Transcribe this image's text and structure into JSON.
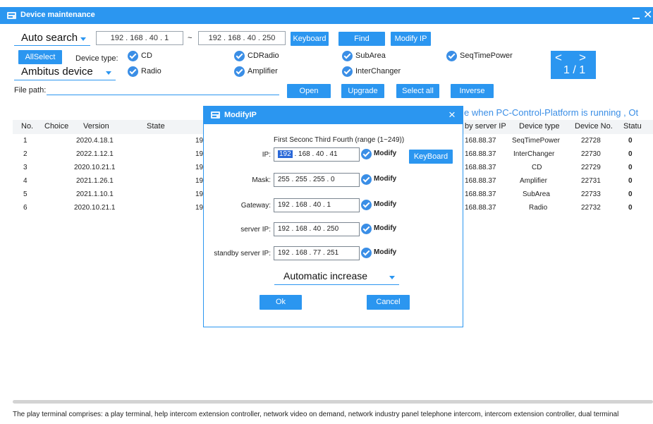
{
  "window": {
    "title": "Device maintenance"
  },
  "search": {
    "mode": "Auto search",
    "ip_start": "192  .  168  .  40  .   1",
    "separator": "~",
    "ip_end": "192  .  168  .  40  .  250",
    "keyboard_label": "Keyboard",
    "find_label": "Find",
    "modify_ip_label": "Modify IP"
  },
  "filter": {
    "allselect_label": "AllSelect",
    "device_type_label": "Device type:",
    "ambitus": "Ambitus device",
    "types": [
      {
        "label": "CD"
      },
      {
        "label": "CDRadio"
      },
      {
        "label": "SubArea"
      },
      {
        "label": "SeqTimePower"
      },
      {
        "label": "Radio"
      },
      {
        "label": "Amplifier"
      },
      {
        "label": "InterChanger"
      }
    ]
  },
  "pager": {
    "prev": "<",
    "next": ">",
    "page": "1 / 1"
  },
  "file": {
    "path_label": "File path:",
    "open_label": "Open",
    "upgrade_label": "Upgrade",
    "select_all_label": "Select all",
    "inverse_label": "Inverse"
  },
  "marquee": "e when PC-Control-Platform is running ,  Ot",
  "table": {
    "headers": {
      "no": "No.",
      "choice": "Choice",
      "version": "Version",
      "state": "State",
      "server_ip": "by server IP",
      "device_type": "Device type",
      "device_no": "Device No.",
      "status": "Statu"
    },
    "rows": [
      {
        "no": "1",
        "version": "2020.4.18.1",
        "ip": "19",
        "server_ip": "168.88.37",
        "device_type": "SeqTimePower",
        "device_no": "22728",
        "status": "0"
      },
      {
        "no": "2",
        "version": "2022.1.12.1",
        "ip": "19",
        "server_ip": "168.88.37",
        "device_type": "InterChanger",
        "device_no": "22730",
        "status": "0"
      },
      {
        "no": "3",
        "version": "2020.10.21.1",
        "ip": "19",
        "server_ip": "168.88.37",
        "device_type": "CD",
        "device_no": "22729",
        "status": "0"
      },
      {
        "no": "4",
        "version": "2021.1.26.1",
        "ip": "19",
        "server_ip": "168.88.37",
        "device_type": "Amplifier",
        "device_no": "22731",
        "status": "0"
      },
      {
        "no": "5",
        "version": "2021.1.10.1",
        "ip": "19",
        "server_ip": "168.88.37",
        "device_type": "SubArea",
        "device_no": "22733",
        "status": "0"
      },
      {
        "no": "6",
        "version": "2020.10.21.1",
        "ip": "19",
        "server_ip": "168.88.37",
        "device_type": "Radio",
        "device_no": "22732",
        "status": "0"
      }
    ]
  },
  "bottom_text": "The play terminal comprises: a play terminal, help intercom extension controller, network video on demand, network industry panel telephone intercom, intercom extension controller, dual terminal",
  "dialog": {
    "title": "ModifyIP",
    "close": "×",
    "header_hint": "First   Seconc  Third   Fourth (range (1~249))",
    "keyboard_label": "KeyBoard",
    "modify_label": "Modify",
    "ip_label": "IP:",
    "ip_first": "192",
    "ip_rest": " .  168  .  40  .  41",
    "mask_label": "Mask:",
    "mask_value": "255  .  255  .  255  .   0",
    "gateway_label": "Gateway:",
    "gateway_value": "192  .  168  .  40  .   1",
    "server_ip_label": "server IP:",
    "server_ip_value": "192  .  168  .  40  .  250",
    "standby_label": "standby server IP:",
    "standby_value": "192  .  168  .  77  .  251",
    "auto_increase": "Automatic increase",
    "ok_label": "Ok",
    "cancel_label": "Cancel"
  },
  "colors": {
    "accent": "#2b96f0",
    "check": "#3a8ee6",
    "selection": "#2a68d8"
  }
}
